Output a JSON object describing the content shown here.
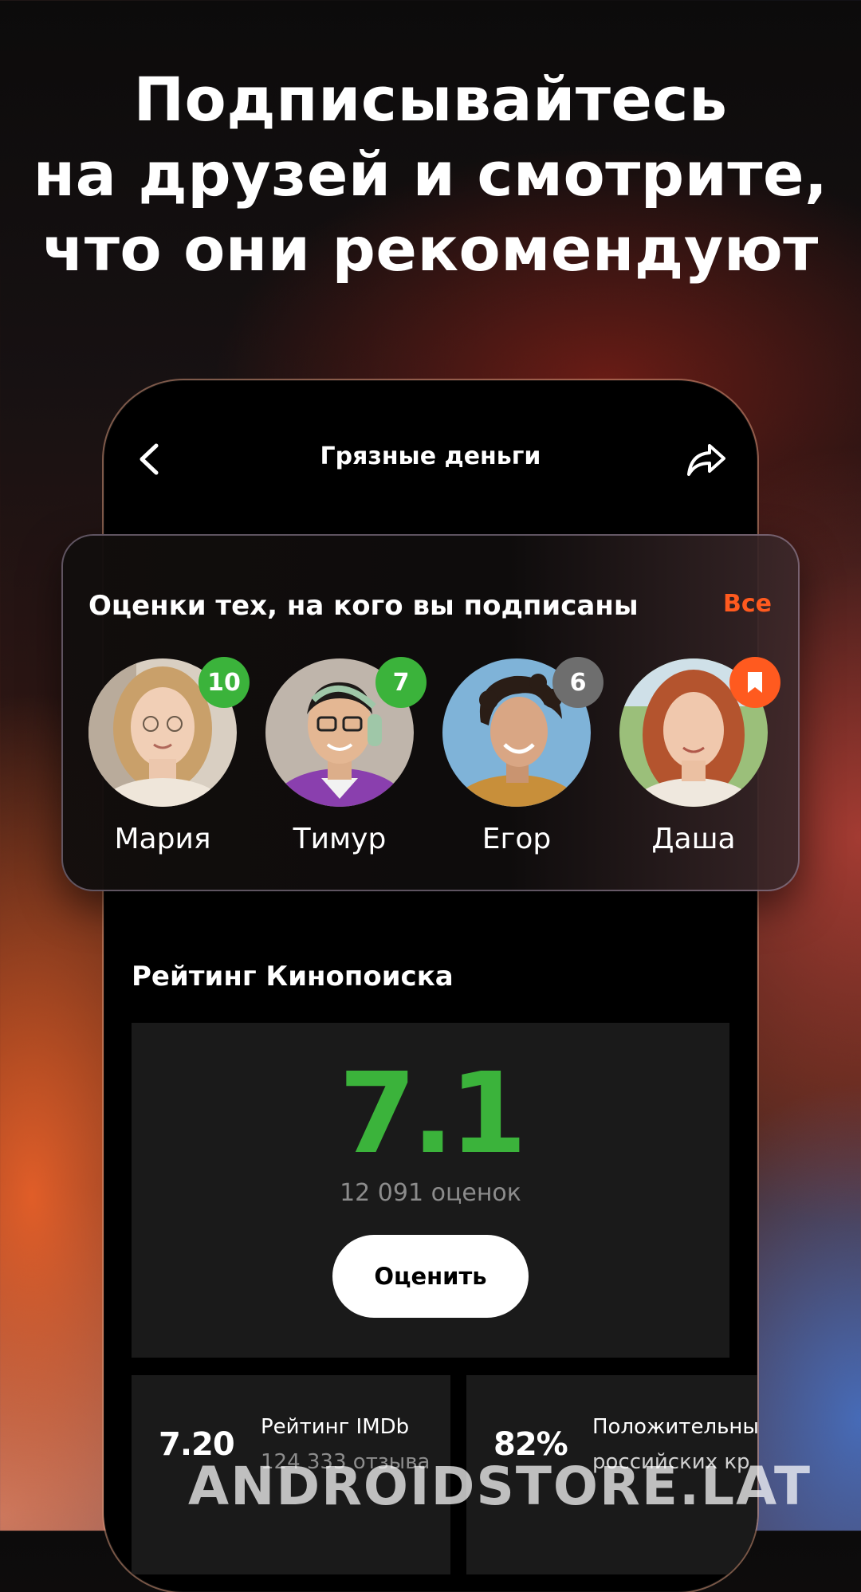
{
  "headline": {
    "line1": "Подписывайтесь",
    "line2": "на друзей и смотрите,",
    "line3": "что они рекомендуют"
  },
  "nav": {
    "title": "Грязные деньги",
    "back_icon": "chevron-left-icon",
    "share_icon": "share-arrow-icon"
  },
  "friends": {
    "title": "Оценки тех, на кого вы подписаны",
    "see_all": "Все",
    "items": [
      {
        "name": "Мария",
        "rating": "10",
        "badge_color": "#3bb33b"
      },
      {
        "name": "Тимур",
        "rating": "7",
        "badge_color": "#3bb33b"
      },
      {
        "name": "Егор",
        "rating": "6",
        "badge_color": "#6e6e6e"
      },
      {
        "name": "Даша",
        "rating": "",
        "badge_icon": "bookmark-icon",
        "badge_color": "#ff5a1f"
      }
    ]
  },
  "kinopoisk": {
    "title": "Рейтинг Кинопоиска",
    "score": "7.1",
    "count": "12 091 оценок",
    "rate_button": "Оценить",
    "score_color": "#3bb33b"
  },
  "imdb": {
    "value": "7.20",
    "label": "Рейтинг IMDb",
    "sub": "124 333 отзыва"
  },
  "critics": {
    "value": "82%",
    "label": "Положительны",
    "sub": "российских кр"
  },
  "watermark": "ANDROIDSTORE.LAT",
  "colors": {
    "accent": "#ff5a1f",
    "positive": "#3bb33b"
  }
}
